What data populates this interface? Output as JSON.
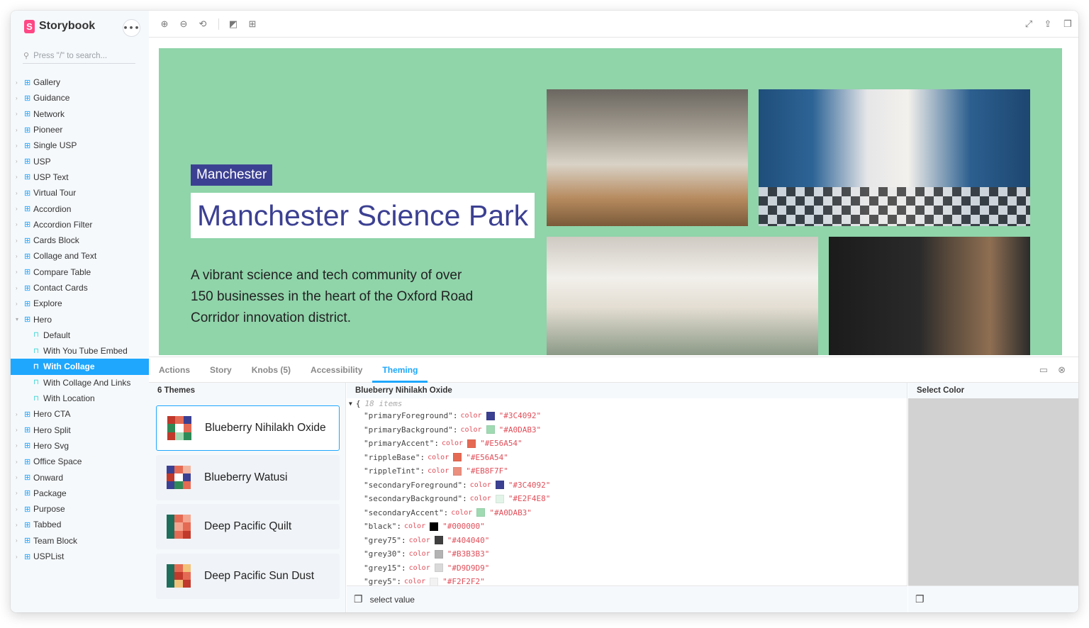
{
  "brand": {
    "name": "Storybook",
    "logo_letter": "S"
  },
  "search": {
    "placeholder": "Press \"/\" to search..."
  },
  "sidebar": {
    "items": [
      {
        "label": "Gallery",
        "type": "component"
      },
      {
        "label": "Guidance",
        "type": "component"
      },
      {
        "label": "Network",
        "type": "component"
      },
      {
        "label": "Pioneer",
        "type": "component"
      },
      {
        "label": "Single USP",
        "type": "component"
      },
      {
        "label": "USP",
        "type": "component"
      },
      {
        "label": "USP Text",
        "type": "component"
      },
      {
        "label": "Virtual Tour",
        "type": "component"
      },
      {
        "label": "Accordion",
        "type": "component"
      },
      {
        "label": "Accordion Filter",
        "type": "component"
      },
      {
        "label": "Cards Block",
        "type": "component"
      },
      {
        "label": "Collage and Text",
        "type": "component"
      },
      {
        "label": "Compare Table",
        "type": "component"
      },
      {
        "label": "Contact Cards",
        "type": "component"
      },
      {
        "label": "Explore",
        "type": "component"
      },
      {
        "label": "Hero",
        "type": "component",
        "expanded": true
      },
      {
        "label": "Default",
        "type": "story"
      },
      {
        "label": "With You Tube Embed",
        "type": "story"
      },
      {
        "label": "With Collage",
        "type": "story",
        "selected": true
      },
      {
        "label": "With Collage And Links",
        "type": "story"
      },
      {
        "label": "With Location",
        "type": "story"
      },
      {
        "label": "Hero CTA",
        "type": "component"
      },
      {
        "label": "Hero Split",
        "type": "component"
      },
      {
        "label": "Hero Svg",
        "type": "component"
      },
      {
        "label": "Office Space",
        "type": "component"
      },
      {
        "label": "Onward",
        "type": "component"
      },
      {
        "label": "Package",
        "type": "component"
      },
      {
        "label": "Purpose",
        "type": "component"
      },
      {
        "label": "Tabbed",
        "type": "component"
      },
      {
        "label": "Team Block",
        "type": "component"
      },
      {
        "label": "USPList",
        "type": "component"
      }
    ]
  },
  "hero": {
    "tag": "Manchester",
    "title": "Manchester Science Park",
    "text": "A vibrant science and tech community of over 150 businesses in the heart of the Oxford Road Corridor innovation district.",
    "background_color": "#90d4aa",
    "accent_color": "#3c4092"
  },
  "addon_tabs": [
    {
      "label": "Actions",
      "active": false
    },
    {
      "label": "Story",
      "active": false
    },
    {
      "label": "Knobs (5)",
      "active": false
    },
    {
      "label": "Accessibility",
      "active": false
    },
    {
      "label": "Theming",
      "active": true
    }
  ],
  "themes": {
    "header": "6 Themes",
    "items": [
      {
        "name": "Blueberry Nihilakh Oxide",
        "active": true,
        "swatch": [
          "#c0392b",
          "#e56a54",
          "#3c4092",
          "#2e8b57",
          "#ffffff",
          "#e56a54",
          "#c0392b",
          "#a0dab3",
          "#2e8b57"
        ]
      },
      {
        "name": "Blueberry Watusi",
        "active": false,
        "swatch": [
          "#3c4092",
          "#e56a54",
          "#f2b5a0",
          "#c0392b",
          "#ffffff",
          "#3c4092",
          "#3c4092",
          "#2e8b57",
          "#e56a54"
        ]
      },
      {
        "name": "Deep Pacific Quilt",
        "active": false,
        "swatch": [
          "#1f6e5c",
          "#e56a54",
          "#f4a58f",
          "#1f6e5c",
          "#f4a58f",
          "#e56a54",
          "#1f6e5c",
          "#e56a54",
          "#c0392b"
        ]
      },
      {
        "name": "Deep Pacific Sun Dust",
        "active": false,
        "swatch": [
          "#1f6e5c",
          "#e56a54",
          "#f2c27a",
          "#1f6e5c",
          "#c0392b",
          "#e56a54",
          "#1f6e5c",
          "#f2c27a",
          "#c0392b"
        ]
      }
    ]
  },
  "json_viewer": {
    "header": "Blueberry Nihilakh Oxide",
    "open_brace": "{",
    "item_count": "18 items",
    "type_label": "color",
    "entries": [
      {
        "key": "\"primaryForeground\"",
        "value": "\"#3C4092\"",
        "color": "#3C4092"
      },
      {
        "key": "\"primaryBackground\"",
        "value": "\"#A0DAB3\"",
        "color": "#A0DAB3"
      },
      {
        "key": "\"primaryAccent\"",
        "value": "\"#E56A54\"",
        "color": "#E56A54"
      },
      {
        "key": "\"rippleBase\"",
        "value": "\"#E56A54\"",
        "color": "#E56A54"
      },
      {
        "key": "\"rippleTint\"",
        "value": "\"#EB8F7F\"",
        "color": "#EB8F7F"
      },
      {
        "key": "\"secondaryForeground\"",
        "value": "\"#3C4092\"",
        "color": "#3C4092"
      },
      {
        "key": "\"secondaryBackground\"",
        "value": "\"#E2F4E8\"",
        "color": "#E2F4E8"
      },
      {
        "key": "\"secondaryAccent\"",
        "value": "\"#A0DAB3\"",
        "color": "#A0DAB3"
      },
      {
        "key": "\"black\"",
        "value": "\"#000000\"",
        "color": "#000000"
      },
      {
        "key": "\"grey75\"",
        "value": "\"#404040\"",
        "color": "#404040"
      },
      {
        "key": "\"grey30\"",
        "value": "\"#B3B3B3\"",
        "color": "#B3B3B3"
      },
      {
        "key": "\"grey15\"",
        "value": "\"#D9D9D9\"",
        "color": "#D9D9D9"
      },
      {
        "key": "\"grey5\"",
        "value": "\"#F2F2F2\"",
        "color": "#F2F2F2"
      }
    ],
    "footer": "select value"
  },
  "picker": {
    "header": "Select Color"
  },
  "colors": {
    "accent": "#1ea7fd",
    "brand": "#ff4785"
  },
  "icons": {
    "toolbar_left": [
      "zoom-in-icon",
      "zoom-out-icon",
      "zoom-reset-icon",
      "background-icon",
      "grid-icon"
    ],
    "toolbar_right": [
      "fullscreen-icon",
      "share-icon",
      "copy-link-icon"
    ]
  }
}
